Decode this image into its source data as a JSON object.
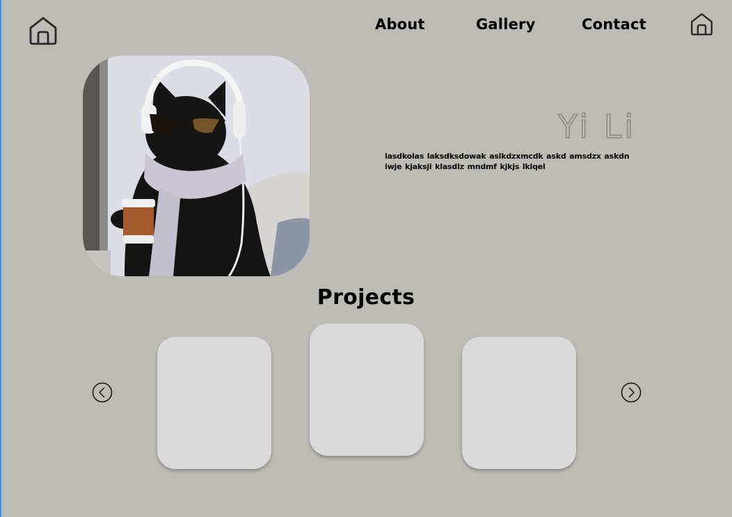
{
  "nav": {
    "home_icon": "home-icon",
    "links": [
      {
        "label": "About"
      },
      {
        "label": "Gallery"
      },
      {
        "label": "Contact"
      }
    ]
  },
  "hero": {
    "name": "Yi Li",
    "bio": "lasdkolas laksdksdowak aslkdzxmcdk askd  amsdzx  askdn iwje kjaksji klasdlz mndmf kjkjs lklqel",
    "photo_subject": "black cat wearing headphones, sunglasses, scarf, holding a coffee cup"
  },
  "projects": {
    "title": "Projects",
    "cards": [
      {},
      {},
      {}
    ],
    "prev_icon": "chevron-left-icon",
    "next_icon": "chevron-right-icon"
  },
  "colors": {
    "background": "#bcbbb6",
    "card": "#d9d9d9",
    "text": "#000000"
  }
}
